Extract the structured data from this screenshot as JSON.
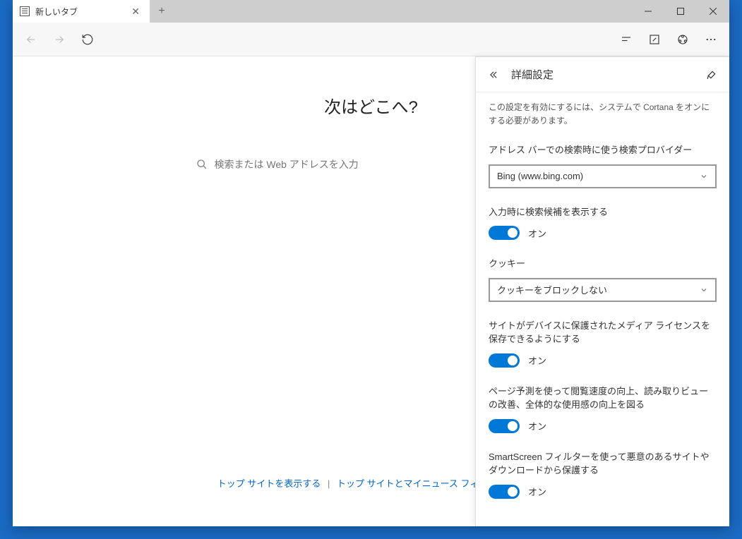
{
  "tab": {
    "title": "新しいタブ"
  },
  "page": {
    "heading": "次はどこへ?",
    "search_placeholder": "検索または Web アドレスを入力"
  },
  "footer": {
    "link1": "トップ サイトを表示する",
    "sep": "|",
    "link2": "トップ サイトとマイニュース フィードを表示"
  },
  "panel": {
    "title": "詳細設定",
    "note": "この設定を有効にするには、システムで Cortana をオンにする必要があります。",
    "search_provider_label": "アドレス バーでの検索時に使う検索プロバイダー",
    "search_provider_value": "Bing (www.bing.com)",
    "suggestions_label": "入力時に検索候補を表示する",
    "suggestions_state": "オン",
    "cookies_label": "クッキー",
    "cookies_value": "クッキーをブロックしない",
    "media_label": "サイトがデバイスに保護されたメディア ライセンスを保存できるようにする",
    "media_state": "オン",
    "prediction_label": "ページ予測を使って閲覧速度の向上、読み取りビューの改善、全体的な使用感の向上を図る",
    "prediction_state": "オン",
    "smartscreen_label": "SmartScreen フィルターを使って悪意のあるサイトやダウンロードから保護する",
    "smartscreen_state": "オン"
  }
}
